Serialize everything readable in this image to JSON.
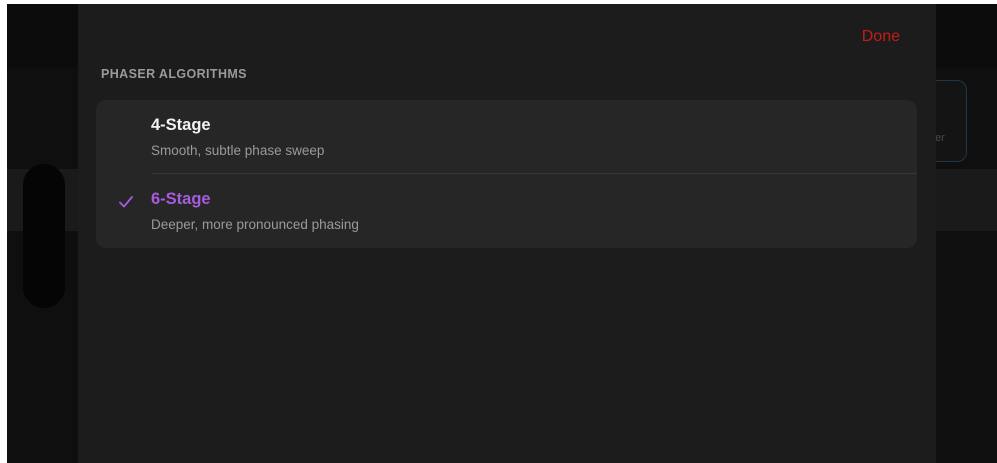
{
  "header": {
    "done_label": "Done"
  },
  "section": {
    "title": "PHASER ALGORITHMS"
  },
  "options": [
    {
      "title": "4-Stage",
      "description": "Smooth, subtle phase sweep",
      "selected": false
    },
    {
      "title": "6-Stage",
      "description": "Deeper, more pronounced phasing",
      "selected": true
    }
  ],
  "background": {
    "card_text": "er"
  },
  "colors": {
    "accent": "#a65cdc",
    "done": "#c41c1c",
    "sheet": "#1c1c1c",
    "list": "#262626"
  },
  "icons": {
    "selected_marker": "checkmark-icon"
  }
}
